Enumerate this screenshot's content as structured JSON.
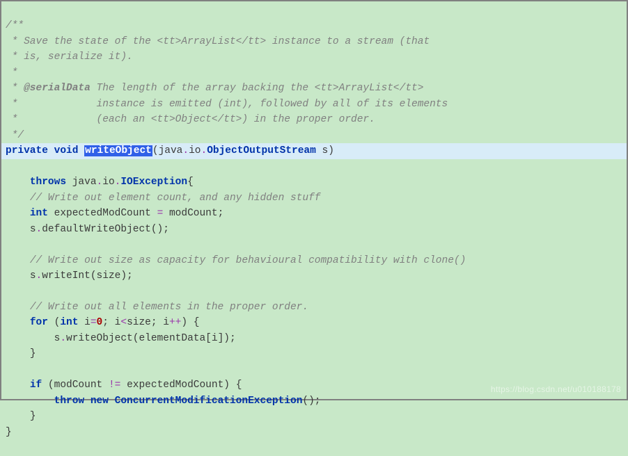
{
  "doc": {
    "l1": "/**",
    "l2_a": " * Save the state of the ",
    "l2_b": "<tt>",
    "l2_c": "ArrayList",
    "l2_d": "</tt>",
    "l2_e": " instance to a stream (that",
    "l3": " * is, serialize it).",
    "l4": " *",
    "l5_a": " * ",
    "l5_b": "@serialData",
    "l5_c": " The length of the array backing the ",
    "l5_d": "<tt>",
    "l5_e": "ArrayList",
    "l5_f": "</tt>",
    "l6": " *             instance is emitted (int), followed by all of its elements",
    "l7_a": " *             (each an ",
    "l7_b": "<tt>",
    "l7_c": "Object",
    "l7_d": "</tt>",
    "l7_e": ") in the proper order.",
    "l8": " */"
  },
  "sig": {
    "private": "private",
    "void": "void",
    "method": "writeObject",
    "pkg1": "java",
    "pkg2": "io",
    "type": "ObjectOutputStream",
    "param": "s"
  },
  "throws": {
    "kw": "throws",
    "pkg1": "java",
    "pkg2": "io",
    "type": "IOException"
  },
  "c1": "// Write out element count, and any hidden stuff",
  "line1": {
    "kw": "int",
    "var": "expectedModCount",
    "eq": "=",
    "rhs": "modCount"
  },
  "line2": {
    "obj": "s",
    "call": "defaultWriteObject"
  },
  "c2": "// Write out size as capacity for behavioural compatibility with clone()",
  "line3": {
    "obj": "s",
    "call": "writeInt",
    "arg": "size"
  },
  "c3": "// Write out all elements in the proper order.",
  "for": {
    "kw": "for",
    "int": "int",
    "var": "i",
    "zero": "0",
    "cond_lhs": "i",
    "cond_op": "<",
    "cond_field": "size",
    "step_var": "i",
    "step_op": "++"
  },
  "line4": {
    "obj": "s",
    "call": "writeObject",
    "arr": "elementData",
    "idx": "i"
  },
  "ifblk": {
    "kw": "if",
    "lhs": "modCount",
    "op": "!=",
    "rhs": "expectedModCount",
    "throw": "throw",
    "new": "new",
    "ex": "ConcurrentModificationException"
  },
  "watermark": "https://blog.csdn.net/u010188178"
}
